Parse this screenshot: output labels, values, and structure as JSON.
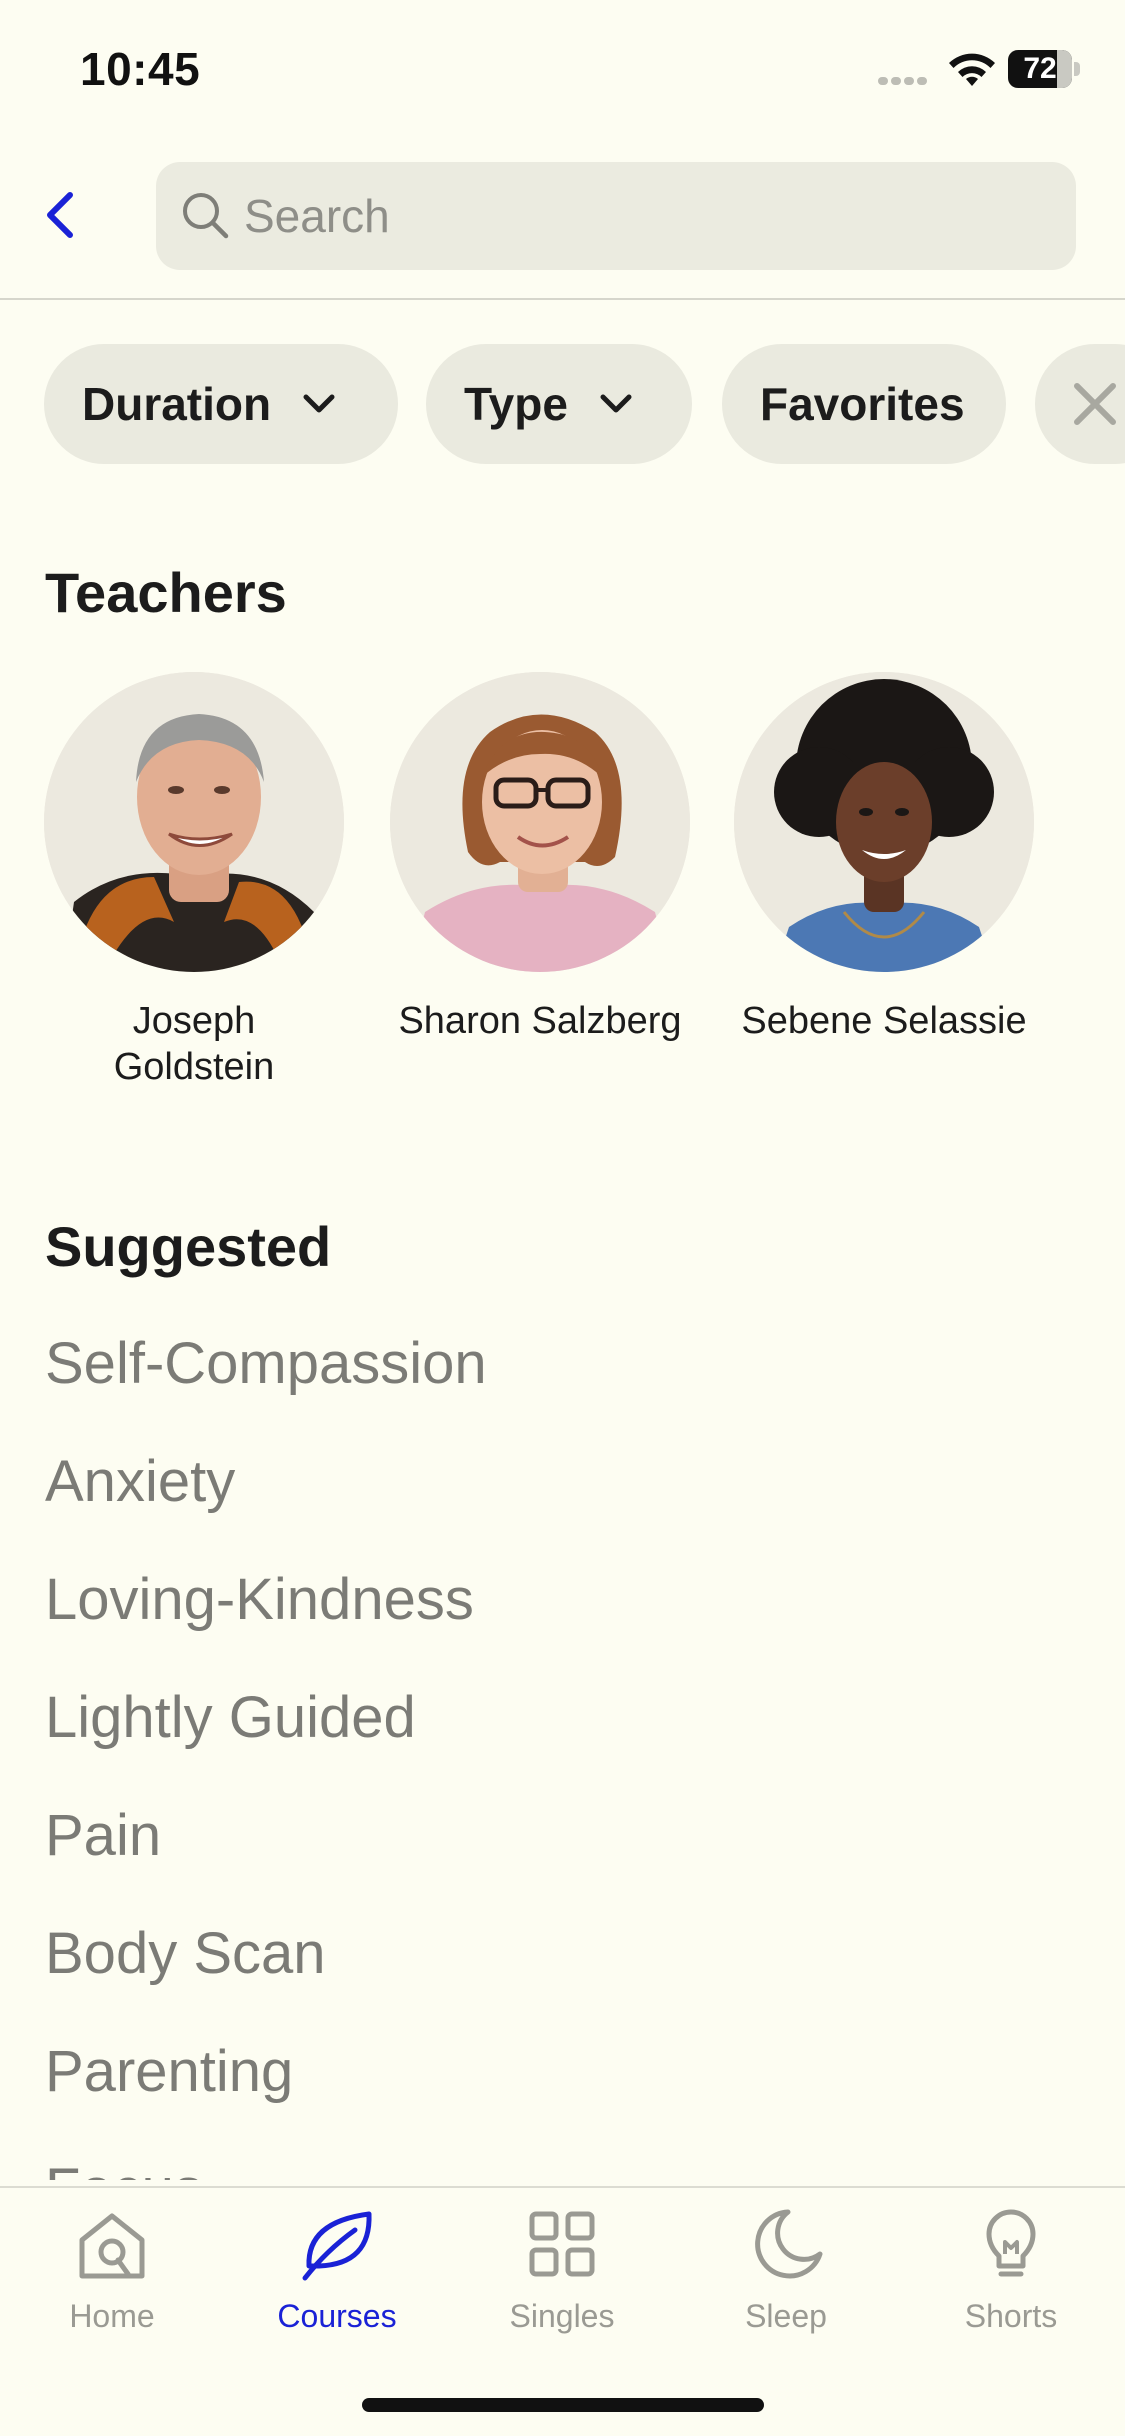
{
  "status_bar": {
    "time": "10:45",
    "battery": "72"
  },
  "search": {
    "placeholder": "Search",
    "value": ""
  },
  "filters": [
    {
      "label": "Duration",
      "has_dropdown": true
    },
    {
      "label": "Type",
      "has_dropdown": true
    },
    {
      "label": "Favorites",
      "has_dropdown": false
    }
  ],
  "teachers": {
    "title": "Teachers",
    "items": [
      {
        "name": "Joseph Goldstein"
      },
      {
        "name": "Sharon Salzberg"
      },
      {
        "name": "Sebene Selassie"
      }
    ]
  },
  "suggested": {
    "title": "Suggested",
    "items": [
      "Self-Compassion",
      "Anxiety",
      "Loving-Kindness",
      "Lightly Guided",
      "Pain",
      "Body Scan",
      "Parenting",
      "Focus"
    ]
  },
  "tab_bar": {
    "active": "Courses",
    "tabs": [
      {
        "label": "Home",
        "icon": "home-icon"
      },
      {
        "label": "Courses",
        "icon": "leaf-icon"
      },
      {
        "label": "Singles",
        "icon": "grid-icon"
      },
      {
        "label": "Sleep",
        "icon": "moon-icon"
      },
      {
        "label": "Shorts",
        "icon": "lightbulb-icon"
      }
    ]
  },
  "colors": {
    "background": "#fdfdf2",
    "accent": "#1a22d6",
    "chip": "#eaeadf",
    "muted_text": "#7b7b76"
  }
}
